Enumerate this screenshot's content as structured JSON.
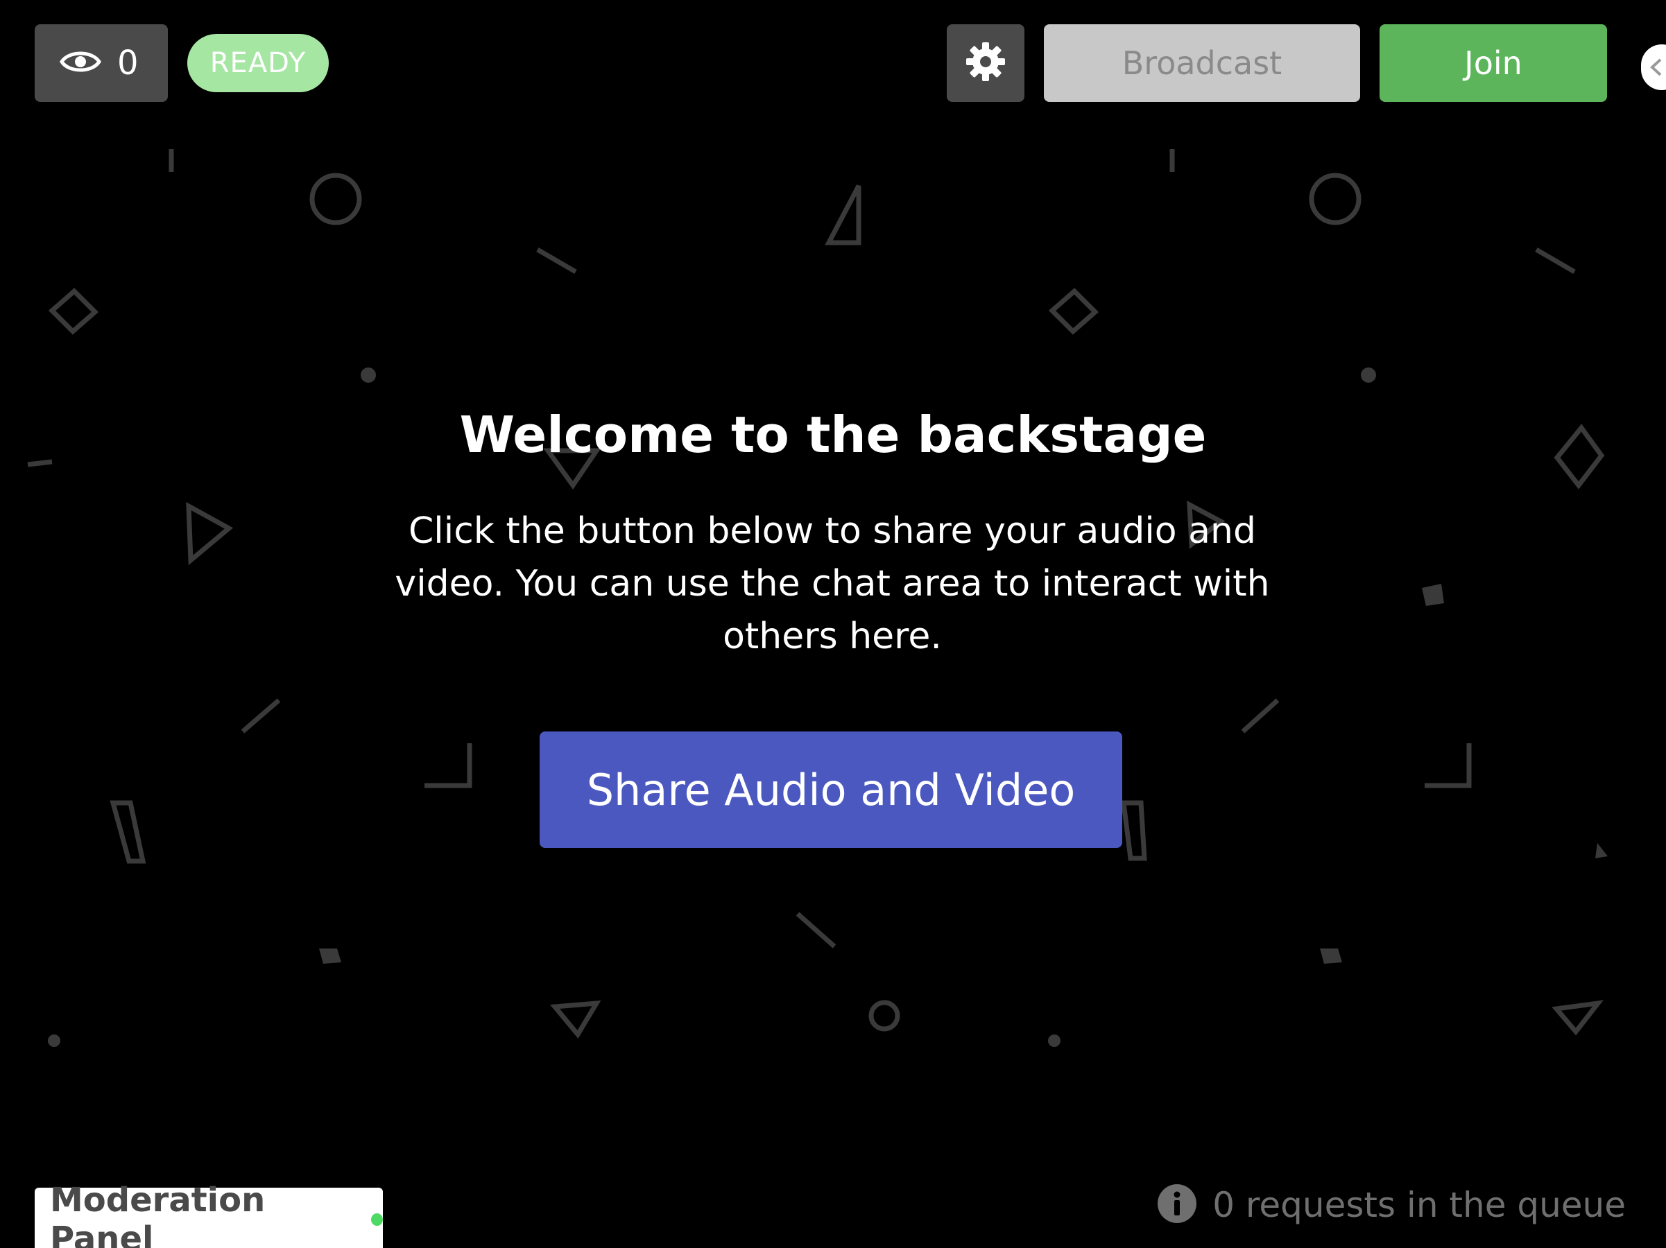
{
  "header": {
    "viewer_icon": "eye-icon",
    "viewer_count": "0",
    "status_badge": "READY",
    "settings_icon": "gear-icon",
    "broadcast_label": "Broadcast",
    "join_label": "Join",
    "side_handle_icon": "chevron-left-icon"
  },
  "main": {
    "title": "Welcome to the backstage",
    "body": "Click the button below to share your audio and video. You can use the chat area to interact with others here.",
    "share_button_label": "Share Audio and Video"
  },
  "footer": {
    "moderation_panel_label": "Moderation Panel",
    "queue_icon": "info-icon",
    "queue_text": "0 requests in the queue"
  },
  "colors": {
    "background": "#000000",
    "pill_bg": "#4a4a4a",
    "ready_bg": "#a6e6a3",
    "broadcast_bg": "#c8c8c8",
    "join_bg": "#5cb55a",
    "share_bg": "#4a58c0",
    "status_dot": "#4cd964",
    "pattern": "#3a3a3a"
  }
}
